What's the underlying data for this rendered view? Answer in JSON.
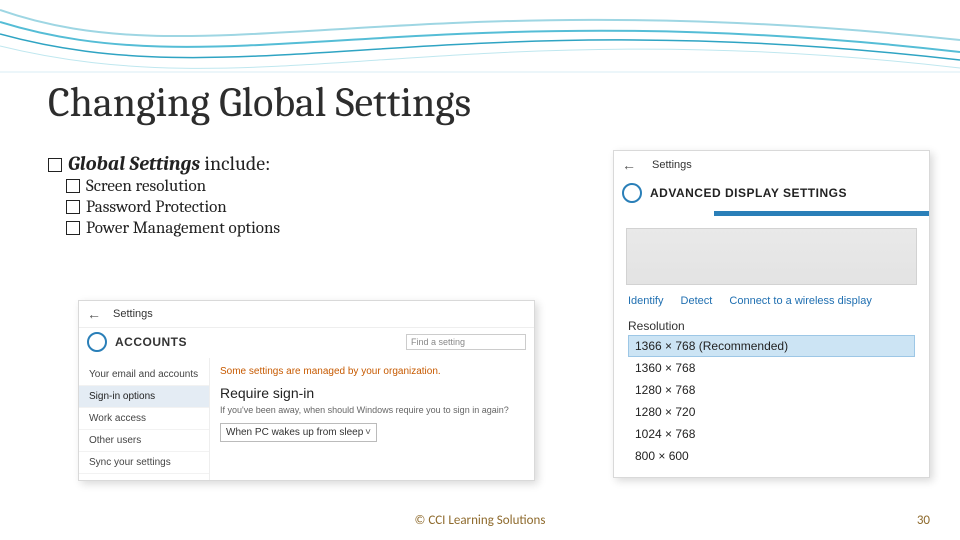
{
  "slide": {
    "title": "Changing Global Settings",
    "lead_prefix": "Global Settings",
    "lead_suffix": " include:",
    "bullets": [
      "Screen resolution",
      "Password Protection",
      "Power Management options"
    ],
    "footer_center": "© CCI Learning Solutions",
    "footer_right": "30"
  },
  "advanced_panel": {
    "settings_label": "Settings",
    "title": "ADVANCED DISPLAY SETTINGS",
    "links": {
      "identify": "Identify",
      "detect": "Detect",
      "connect": "Connect to a wireless display"
    },
    "resolution_label": "Resolution",
    "options": [
      "1366 × 768 (Recommended)",
      "1360 × 768",
      "1280 × 768",
      "1280 × 720",
      "1024 × 768",
      "800 × 600"
    ]
  },
  "accounts_panel": {
    "settings_label": "Settings",
    "title": "ACCOUNTS",
    "find_placeholder": "Find a setting",
    "nav": [
      "Your email and accounts",
      "Sign-in options",
      "Work access",
      "Other users",
      "Sync your settings"
    ],
    "active_nav_index": 1,
    "warn": "Some settings are managed by your organization.",
    "require_heading": "Require sign-in",
    "require_desc": "If you've been away, when should Windows require you to sign in again?",
    "dropdown_value": "When PC wakes up from sleep"
  }
}
